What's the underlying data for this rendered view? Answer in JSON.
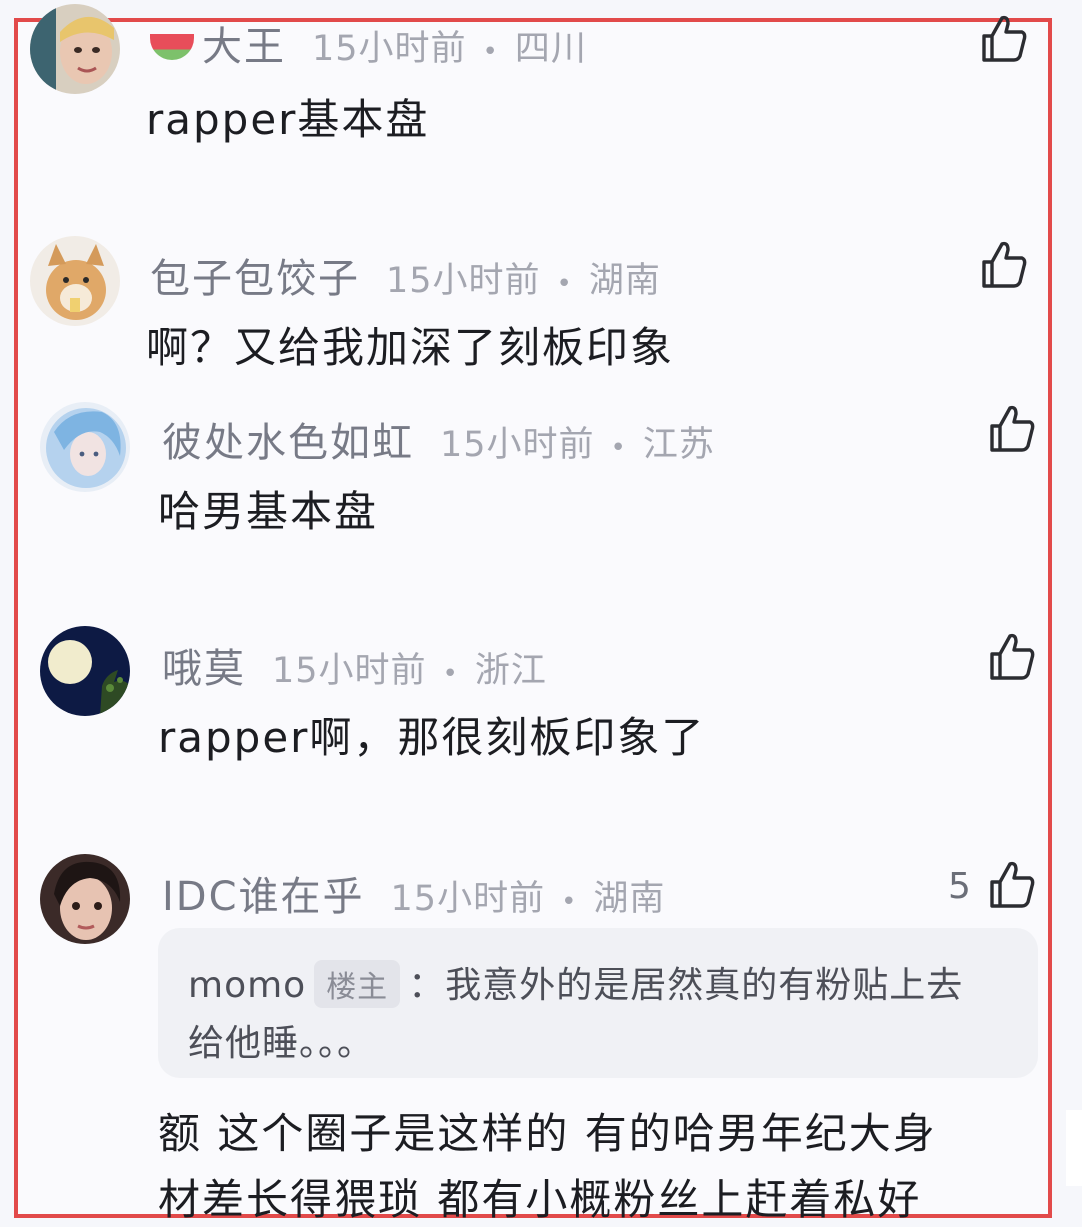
{
  "comments": [
    {
      "username": "大王",
      "time": "15小时前",
      "region": "四川",
      "text": "rapper基本盘",
      "like_count": ""
    },
    {
      "username": "包子包饺子",
      "time": "15小时前",
      "region": "湖南",
      "text": "啊？又给我加深了刻板印象",
      "like_count": ""
    },
    {
      "username": "彼处水色如虹",
      "time": "15小时前",
      "region": "江苏",
      "text": "哈男基本盘",
      "like_count": ""
    },
    {
      "username": "哦莫",
      "time": "15小时前",
      "region": "浙江",
      "text": "rapper啊，那很刻板印象了",
      "like_count": ""
    },
    {
      "username": "IDC谁在乎",
      "time": "15小时前",
      "region": "湖南",
      "text": "额 这个圈子是这样的 有的哈男年纪大身",
      "text_cut": "材差长得猥琐 都有小概粉丝上赶着私好",
      "like_count": "5",
      "quote": {
        "author": "momo",
        "badge": "楼主",
        "line1": "：我意外的是居然真的有粉贴上去",
        "line2": "给他睡。。。"
      }
    }
  ],
  "colors": {
    "frame": "#e24a4a",
    "username": "#777a86",
    "meta": "#a4a6b0",
    "text": "#1c1d22"
  },
  "icons": {
    "like": "thumbs-up-icon",
    "avatar": "avatar"
  }
}
